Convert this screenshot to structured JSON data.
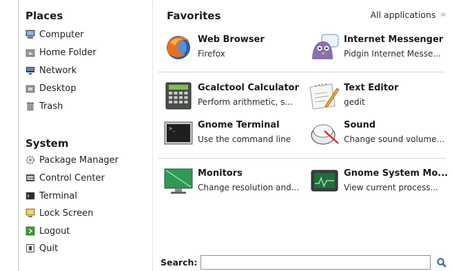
{
  "places": {
    "title": "Places",
    "items": [
      {
        "label": "Computer",
        "icon": "computer-icon"
      },
      {
        "label": "Home Folder",
        "icon": "home-folder-icon"
      },
      {
        "label": "Network",
        "icon": "network-icon"
      },
      {
        "label": "Desktop",
        "icon": "desktop-icon"
      },
      {
        "label": "Trash",
        "icon": "trash-icon"
      }
    ]
  },
  "system": {
    "title": "System",
    "items": [
      {
        "label": "Package Manager",
        "icon": "package-manager-icon"
      },
      {
        "label": "Control Center",
        "icon": "control-center-icon"
      },
      {
        "label": "Terminal",
        "icon": "terminal-icon"
      },
      {
        "label": "Lock Screen",
        "icon": "lock-screen-icon"
      },
      {
        "label": "Logout",
        "icon": "logout-icon"
      },
      {
        "label": "Quit",
        "icon": "quit-icon"
      }
    ]
  },
  "favorites": {
    "title": "Favorites",
    "all_applications": "All applications",
    "apps": [
      {
        "name": "Web Browser",
        "desc": "Firefox",
        "icon": "firefox-icon"
      },
      {
        "name": "Internet Messenger",
        "desc": "Pidgin Internet Messe...",
        "icon": "pidgin-icon"
      },
      {
        "name": "Gcalctool Calculator",
        "desc": "Perform arithmetic, s...",
        "icon": "calculator-icon"
      },
      {
        "name": "Text Editor",
        "desc": "gedit",
        "icon": "text-editor-icon"
      },
      {
        "name": "Gnome Terminal",
        "desc": "Use the command line",
        "icon": "gnome-terminal-icon"
      },
      {
        "name": "Sound",
        "desc": "Change sound volume...",
        "icon": "sound-icon"
      },
      {
        "name": "Monitors",
        "desc": "Change resolution and...",
        "icon": "monitors-icon"
      },
      {
        "name": "Gnome System Mo...",
        "desc": "View current process...",
        "icon": "system-monitor-icon"
      }
    ]
  },
  "search": {
    "label": "Search:",
    "value": "",
    "placeholder": ""
  },
  "colors": {
    "firefox_orange": "#e8701a",
    "firefox_blue": "#2a5fa8",
    "pidgin_purple": "#8a6fb0",
    "monitor_green": "#2f9a53",
    "logout_green": "#3d9b35"
  }
}
